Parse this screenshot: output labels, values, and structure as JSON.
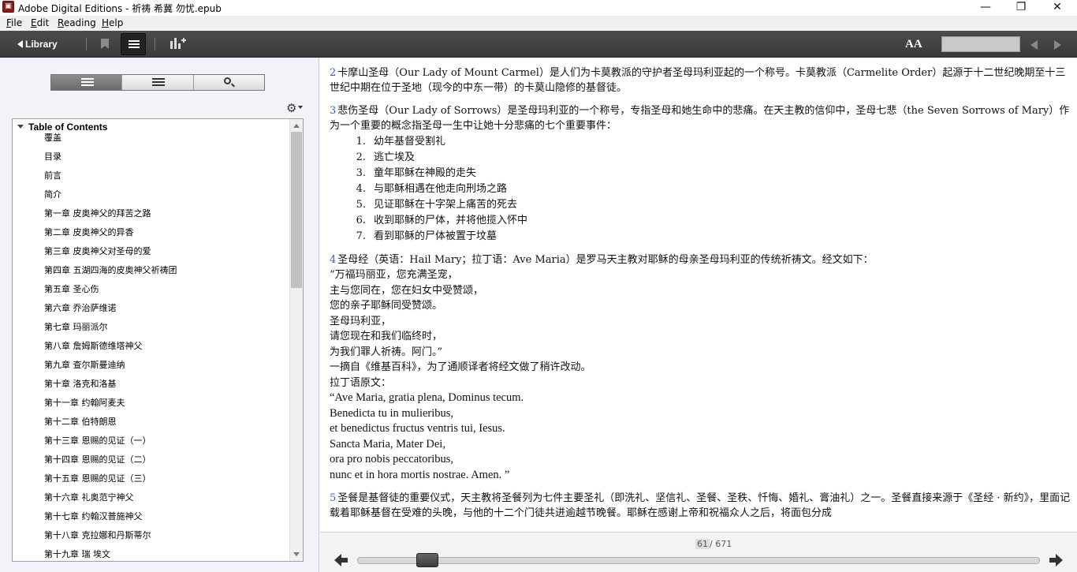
{
  "window": {
    "title": "Adobe Digital Editions - 祈祷 希冀 勿忧.epub",
    "minimize": "—",
    "restore": "❐",
    "close": "✕"
  },
  "menu": [
    {
      "label": "File",
      "mnemonic": "F",
      "rest": "ile"
    },
    {
      "label": "Edit",
      "mnemonic": "E",
      "rest": "dit"
    },
    {
      "label": "Reading",
      "mnemonic": "R",
      "rest": "eading"
    },
    {
      "label": "Help",
      "mnemonic": "H",
      "rest": "elp"
    }
  ],
  "toolbar": {
    "library_label": "Library",
    "font_size_label": "AA",
    "search_value": ""
  },
  "sidebar": {
    "toc_title": "Table of Contents",
    "items": [
      "覆盖",
      "目录",
      "前言",
      "简介",
      "第一章 皮奥神父的拜苦之路",
      "第二章 皮奥神父的异香",
      "第三章 皮奥神父对圣母的爱",
      "第四章 五湖四海的皮奥神父祈祷团",
      "第五章 圣心伤",
      "第六章 乔治萨维诺",
      "第七章 玛丽派尔",
      "第八章 詹姆斯德维塔神父",
      "第九章 查尔斯曼迪纳",
      "第十章 洛克和洛基",
      "第十一章 约翰阿麦夫",
      "第十二章 伯特朗恩",
      "第十三章 恩赐的见证（一）",
      "第十四章 恩赐的见证（二）",
      "第十五章 恩赐的见证（三）",
      "第十六章 礼奥范宁神父",
      "第十七章 约翰汉普施神父",
      "第十八章 克拉娜和丹斯蒂尔",
      "第十九章 瑞 埃文"
    ]
  },
  "content": {
    "note2": {
      "num": "2",
      "text": "卡摩山圣母（Our Lady of Mount Carmel）是人们为卡莫教派的守护者圣母玛利亚起的一个称号。卡莫教派（Carmelite Order）起源于十二世纪晚期至十三世纪中期在位于圣地（现今的中东一带）的卡莫山隐修的基督徒。"
    },
    "note3": {
      "num": "3",
      "text": "悲伤圣母（Our Lady of Sorrows）是圣母玛利亚的一个称号，专指圣母和她生命中的悲痛。在天主教的信仰中，圣母七悲（the Seven Sorrows of Mary）作为一个重要的概念指圣母一生中让她十分悲痛的七个重要事件：",
      "list": [
        {
          "n": "1.",
          "t": "幼年基督受割礼"
        },
        {
          "n": "2.",
          "t": "逃亡埃及"
        },
        {
          "n": "3.",
          "t": "童年耶稣在神殿的走失"
        },
        {
          "n": "4.",
          "t": "与耶稣相遇在他走向刑场之路"
        },
        {
          "n": "5.",
          "t": "见证耶稣在十字架上痛苦的死去"
        },
        {
          "n": "6.",
          "t": "收到耶稣的尸体，并将他揽入怀中"
        },
        {
          "n": "7.",
          "t": "看到耶稣的尸体被置于坟墓"
        }
      ]
    },
    "note4": {
      "num": "4",
      "text": "圣母经（英语：Hail Mary；拉丁语：Ave Maria）是罗马天主教对耶稣的母亲圣母玛利亚的传统祈祷文。经文如下：",
      "prayer_lines": [
        "“万福玛丽亚，您充满圣宠，",
        "主与您同在，您在妇女中受赞颂，",
        "您的亲子耶稣同受赞颂。",
        "圣母玛利亚，",
        "请您现在和我们临终时，",
        "为我们罪人祈祷。阿门。”",
        "一摘自《维基百科》，为了通顺译者将经文做了稍许改动。",
        "拉丁语原文："
      ],
      "latin_lines": [
        "“Ave Maria, gratia plena, Dominus tecum.",
        "Benedicta tu in mulieribus,",
        "et benedictus fructus ventris tui, Iesus.",
        "Sancta Maria, Mater Dei,",
        "ora pro nobis peccatoribus,",
        "nunc et in hora mortis nostrae. Amen. ”"
      ]
    },
    "note5": {
      "num": "5",
      "text": "圣餐是基督徒的重要仪式，天主教将圣餐列为七件主要圣礼（即洗礼、坚信礼、圣餐、圣秩、忏悔、婚礼、膏油礼）之一。圣餐直接来源于《圣经 · 新约》，里面记载着耶稣基督在受难的头晚，与他的十二个门徒共进逾越节晚餐。耶稣在感谢上帝和祝福众人之后，将面包分成"
    }
  },
  "pagination": {
    "current": "61",
    "separator": "/",
    "total": "671",
    "progress": 0.09
  }
}
